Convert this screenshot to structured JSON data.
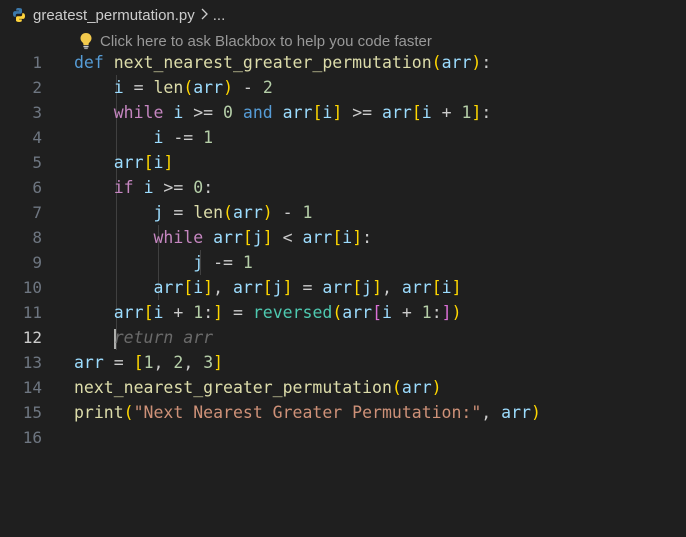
{
  "breadcrumb": {
    "file": "greatest_permutation.py",
    "more": "..."
  },
  "hint": {
    "text": "Click here to ask Blackbox to help you code faster"
  },
  "editor": {
    "active_line": 12,
    "line_numbers": [
      "1",
      "2",
      "3",
      "4",
      "5",
      "6",
      "7",
      "8",
      "9",
      "10",
      "11",
      "12",
      "13",
      "14",
      "15",
      "16"
    ],
    "tokens": {
      "def": "def",
      "fn_name": "next_nearest_greater_permutation",
      "arr": "arr",
      "i": "i",
      "j": "j",
      "len": "len",
      "while": "while",
      "and": "and",
      "if": "if",
      "reversed": "reversed",
      "print": "print",
      "n0": "0",
      "n1": "1",
      "n2": "2",
      "n3": "3",
      "ghost": "return arr",
      "str": "\"Next Nearest Greater Permutation:\""
    }
  },
  "colors": {
    "background": "#1f1f1f",
    "keyword": "#569cd6",
    "control": "#c586c0",
    "function": "#dcdcaa",
    "variable": "#9cdcfe",
    "number": "#b5cea8",
    "string": "#ce9178"
  },
  "icons": {
    "file": "python-icon",
    "hint": "lightbulb-icon",
    "separator": "chevron-right-icon"
  }
}
